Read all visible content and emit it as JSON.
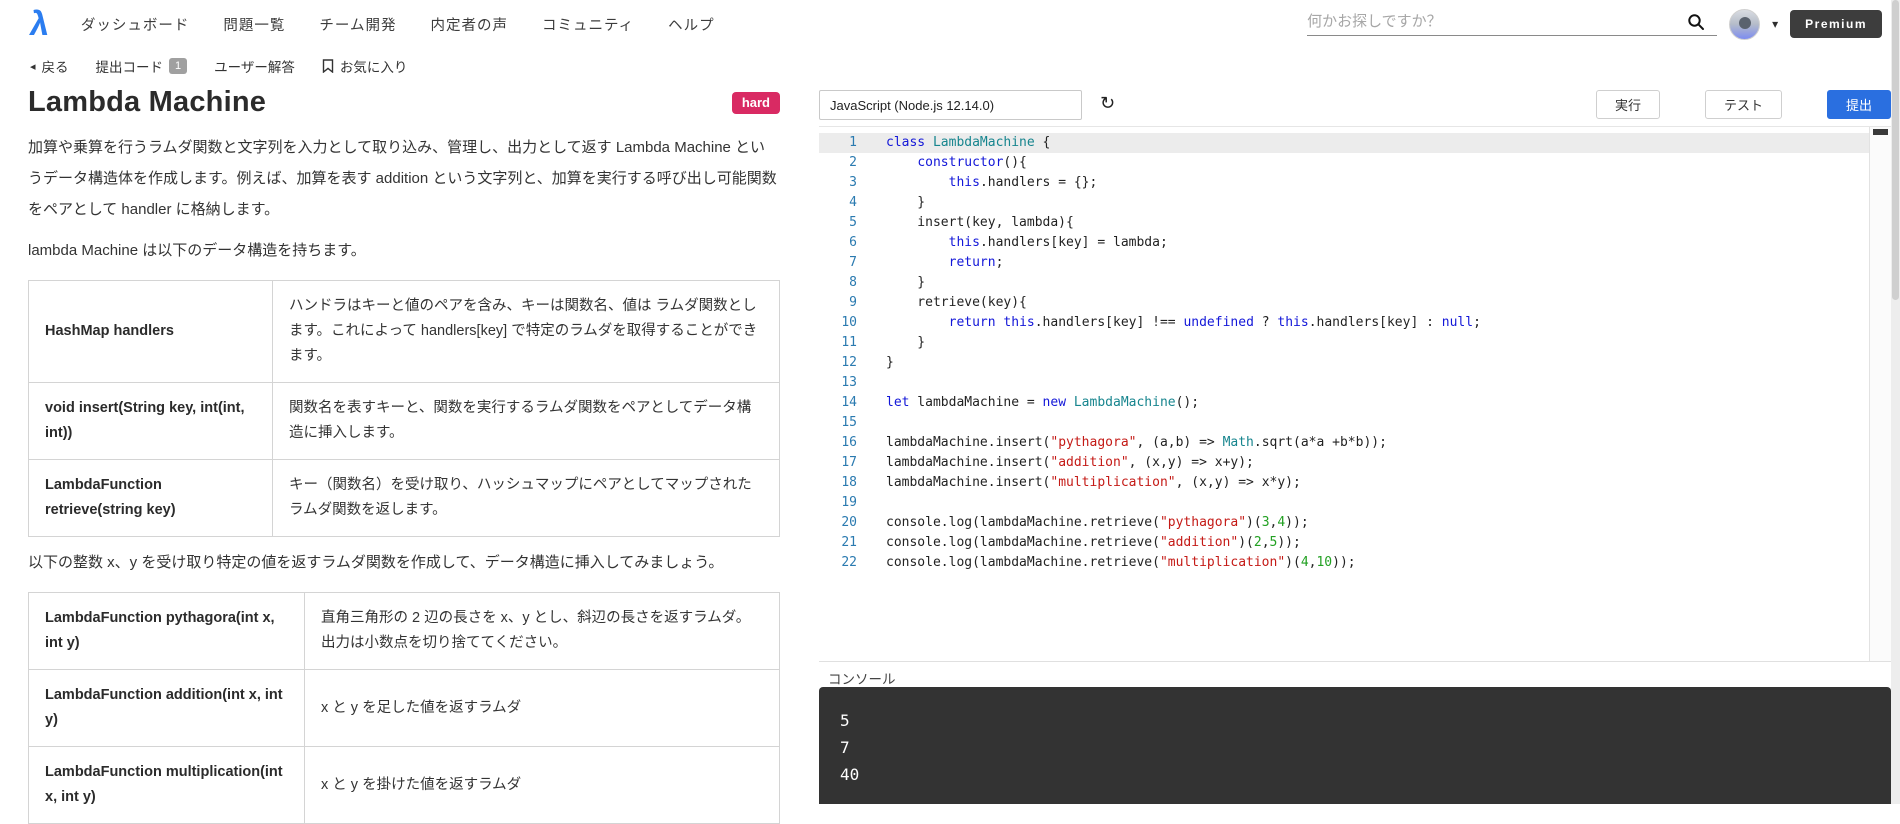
{
  "colors": {
    "brand-blue": "#2b7df0",
    "hard-pink": "#d92a63",
    "submit-blue": "#2a6fe0",
    "premium-dark": "#3d3d3d",
    "kw-blue": "#1317d8",
    "class-teal": "#17858e",
    "string-red": "#c41a16",
    "number-green": "#22a022",
    "line-number-blue": "#2a7ab0",
    "console-bg": "#333333"
  },
  "icons": {
    "back": "◂",
    "caret_down": "▾",
    "refresh": "↻",
    "logo_glyph": "λ"
  },
  "header": {
    "nav": [
      "ダッシュボード",
      "問題一覧",
      "チーム開発",
      "内定者の声",
      "コミュニティ",
      "ヘルプ"
    ],
    "search_placeholder": "何かお探しですか？",
    "premium_label": "Premium"
  },
  "subnav": {
    "back_label": "戻る",
    "submitted_code_label": "提出コード",
    "submitted_count": "1",
    "user_answers_label": "ユーザー解答",
    "favorite_label": "お気に入り"
  },
  "problem": {
    "title": "Lambda Machine",
    "difficulty_label": "hard",
    "intro": "加算や乗算を行うラムダ関数と文字列を入力として取り込み、管理し、出力として返す Lambda Machine というデータ構造体を作成します。例えば、加算を表す addition という文字列と、加算を実行する呼び出し可能関数をペアとして handler に格納します。",
    "structure_lead": "lambda Machine は以下のデータ構造を持ちます。",
    "structure_table": [
      {
        "term": "HashMap handlers",
        "desc": "ハンドラはキーと値のペアを含み、キーは関数名、値は ラムダ関数とします。これによって handlers[key] で特定のラムダを取得することができます。"
      },
      {
        "term": "void insert(String key, int(int, int))",
        "desc": "関数名を表すキーと、関数を実行するラムダ関数をペアとしてデータ構造に挿入します。"
      },
      {
        "term": "LambdaFunction retrieve(string key)",
        "desc": "キー（関数名）を受け取り、ハッシュマップにペアとしてマップされたラムダ関数を返します。"
      }
    ],
    "task_lead": "以下の整数 x、y を受け取り特定の値を返すラムダ関数を作成して、データ構造に挿入してみましょう。",
    "task_table": [
      {
        "term": "LambdaFunction pythagora(int x, int y)",
        "desc": "直角三角形の 2 辺の長さを x、y とし、斜辺の長さを返すラムダ。出力は小数点を切り捨ててください。"
      },
      {
        "term": "LambdaFunction addition(int x, int y)",
        "desc": "x と y を足した値を返すラムダ"
      },
      {
        "term": "LambdaFunction multiplication(int x, int y)",
        "desc": "x と y を掛けた値を返すラムダ"
      }
    ]
  },
  "editor": {
    "language": "JavaScript (Node.js 12.14.0)",
    "run_label": "実行",
    "test_label": "テスト",
    "submit_label": "提出",
    "active_line": 1,
    "code_lines": [
      [
        [
          "kw",
          "class"
        ],
        [
          "txt",
          " "
        ],
        [
          "cls",
          "LambdaMachine"
        ],
        [
          "txt",
          " {"
        ]
      ],
      [
        [
          "txt",
          "    "
        ],
        [
          "kw",
          "constructor"
        ],
        [
          "txt",
          "(){"
        ]
      ],
      [
        [
          "txt",
          "        "
        ],
        [
          "kw",
          "this"
        ],
        [
          "txt",
          ".handlers = {};"
        ]
      ],
      [
        [
          "txt",
          "    }"
        ]
      ],
      [
        [
          "txt",
          "    insert(key, lambda){"
        ]
      ],
      [
        [
          "txt",
          "        "
        ],
        [
          "kw",
          "this"
        ],
        [
          "txt",
          ".handlers[key] = lambda;"
        ]
      ],
      [
        [
          "txt",
          "        "
        ],
        [
          "kw",
          "return"
        ],
        [
          "txt",
          ";"
        ]
      ],
      [
        [
          "txt",
          "    }"
        ]
      ],
      [
        [
          "txt",
          "    retrieve(key){"
        ]
      ],
      [
        [
          "txt",
          "        "
        ],
        [
          "kw",
          "return"
        ],
        [
          "txt",
          " "
        ],
        [
          "kw",
          "this"
        ],
        [
          "txt",
          ".handlers[key] !== "
        ],
        [
          "kw",
          "undefined"
        ],
        [
          "txt",
          " ? "
        ],
        [
          "kw",
          "this"
        ],
        [
          "txt",
          ".handlers[key] : "
        ],
        [
          "kw",
          "null"
        ],
        [
          "txt",
          ";"
        ]
      ],
      [
        [
          "txt",
          "    }"
        ]
      ],
      [
        [
          "txt",
          "}"
        ]
      ],
      [],
      [
        [
          "kw",
          "let"
        ],
        [
          "txt",
          " lambdaMachine = "
        ],
        [
          "kw",
          "new"
        ],
        [
          "txt",
          " "
        ],
        [
          "cls",
          "LambdaMachine"
        ],
        [
          "txt",
          "();"
        ]
      ],
      [],
      [
        [
          "txt",
          "lambdaMachine.insert("
        ],
        [
          "str",
          "\"pythagora\""
        ],
        [
          "txt",
          ", (a,b) => "
        ],
        [
          "cls",
          "Math"
        ],
        [
          "txt",
          ".sqrt(a*a +b*b));"
        ]
      ],
      [
        [
          "txt",
          "lambdaMachine.insert("
        ],
        [
          "str",
          "\"addition\""
        ],
        [
          "txt",
          ", (x,y) => x+y);"
        ]
      ],
      [
        [
          "txt",
          "lambdaMachine.insert("
        ],
        [
          "str",
          "\"multiplication\""
        ],
        [
          "txt",
          ", (x,y) => x*y);"
        ]
      ],
      [],
      [
        [
          "txt",
          "console.log(lambdaMachine.retrieve("
        ],
        [
          "str",
          "\"pythagora\""
        ],
        [
          "txt",
          ")("
        ],
        [
          "num",
          "3"
        ],
        [
          "txt",
          ","
        ],
        [
          "num",
          "4"
        ],
        [
          "txt",
          "));"
        ]
      ],
      [
        [
          "txt",
          "console.log(lambdaMachine.retrieve("
        ],
        [
          "str",
          "\"addition\""
        ],
        [
          "txt",
          ")("
        ],
        [
          "num",
          "2"
        ],
        [
          "txt",
          ","
        ],
        [
          "num",
          "5"
        ],
        [
          "txt",
          "));"
        ]
      ],
      [
        [
          "txt",
          "console.log(lambdaMachine.retrieve("
        ],
        [
          "str",
          "\"multiplication\""
        ],
        [
          "txt",
          ")("
        ],
        [
          "num",
          "4"
        ],
        [
          "txt",
          ","
        ],
        [
          "num",
          "10"
        ],
        [
          "txt",
          "));"
        ]
      ]
    ]
  },
  "console": {
    "label": "コンソール",
    "lines": [
      "5",
      "7",
      "40"
    ]
  }
}
